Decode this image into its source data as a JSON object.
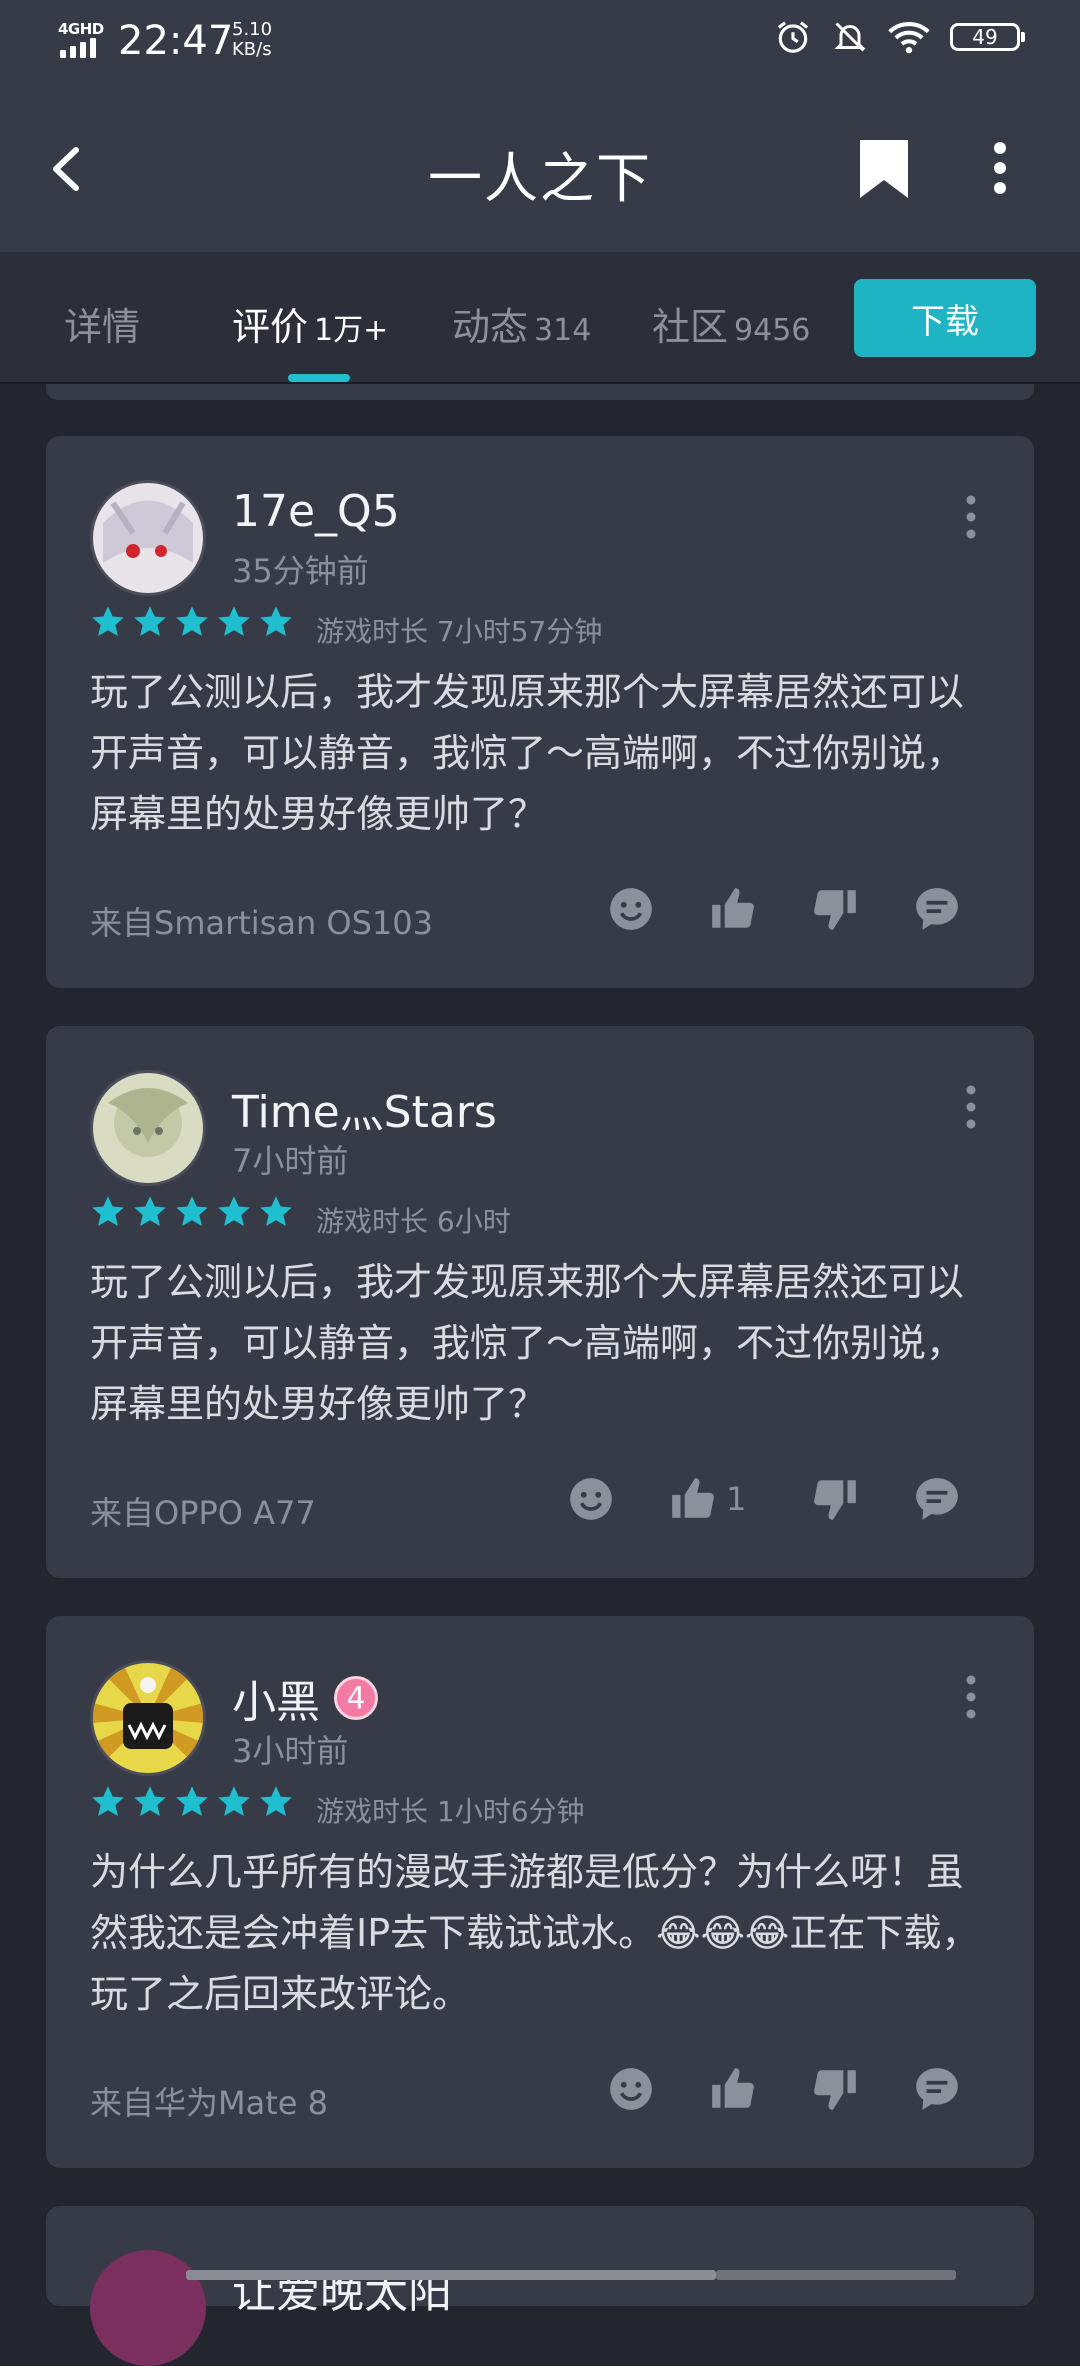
{
  "status_bar": {
    "network": "4GHD",
    "time": "22:47",
    "speed_value": "5.10",
    "speed_unit": "KB/s",
    "battery": "49"
  },
  "app_bar": {
    "title": "一人之下",
    "back_icon": "back-arrow-icon",
    "bookmark_icon": "bookmark-icon",
    "more_icon": "more-vertical-icon"
  },
  "tabs": [
    {
      "label": "详情",
      "count": ""
    },
    {
      "label": "评价",
      "count": "1万+"
    },
    {
      "label": "动态",
      "count": "314"
    },
    {
      "label": "社区",
      "count": "9456"
    }
  ],
  "download_label": "下载",
  "colors": {
    "accent": "#1fb4c4",
    "star": "#1fbfcf",
    "card": "#373b47",
    "background": "#23252f"
  },
  "reviews": [
    {
      "username": "17e_Q5",
      "time": "35分钟前",
      "rating": 5,
      "playtime": "游戏时长 7小时57分钟",
      "text": "玩了公测以后，我才发现原来那个大屏幕居然还可以开声音，可以静音，我惊了～高端啊，不过你别说，屏幕里的处男好像更帅了？",
      "source": "来自Smartisan OS103",
      "likes": ""
    },
    {
      "username": "Time灬Stars",
      "time": "7小时前",
      "rating": 5,
      "playtime": "游戏时长 6小时",
      "text": "玩了公测以后，我才发现原来那个大屏幕居然还可以开声音，可以静音，我惊了～高端啊，不过你别说，屏幕里的处男好像更帅了？",
      "source": "来自OPPO A77",
      "likes": "1"
    },
    {
      "username": "小黑",
      "level": "4",
      "time": "3小时前",
      "rating": 5,
      "playtime": "游戏时长 1小时6分钟",
      "text": "为什么几乎所有的漫改手游都是低分？为什么呀！虽然我还是会冲着IP去下载试试水。😂😂😂正在下载，玩了之后回来改评论。",
      "source": "来自华为Mate 8",
      "likes": ""
    }
  ],
  "next_review": {
    "username": "让爱晚太阳"
  }
}
